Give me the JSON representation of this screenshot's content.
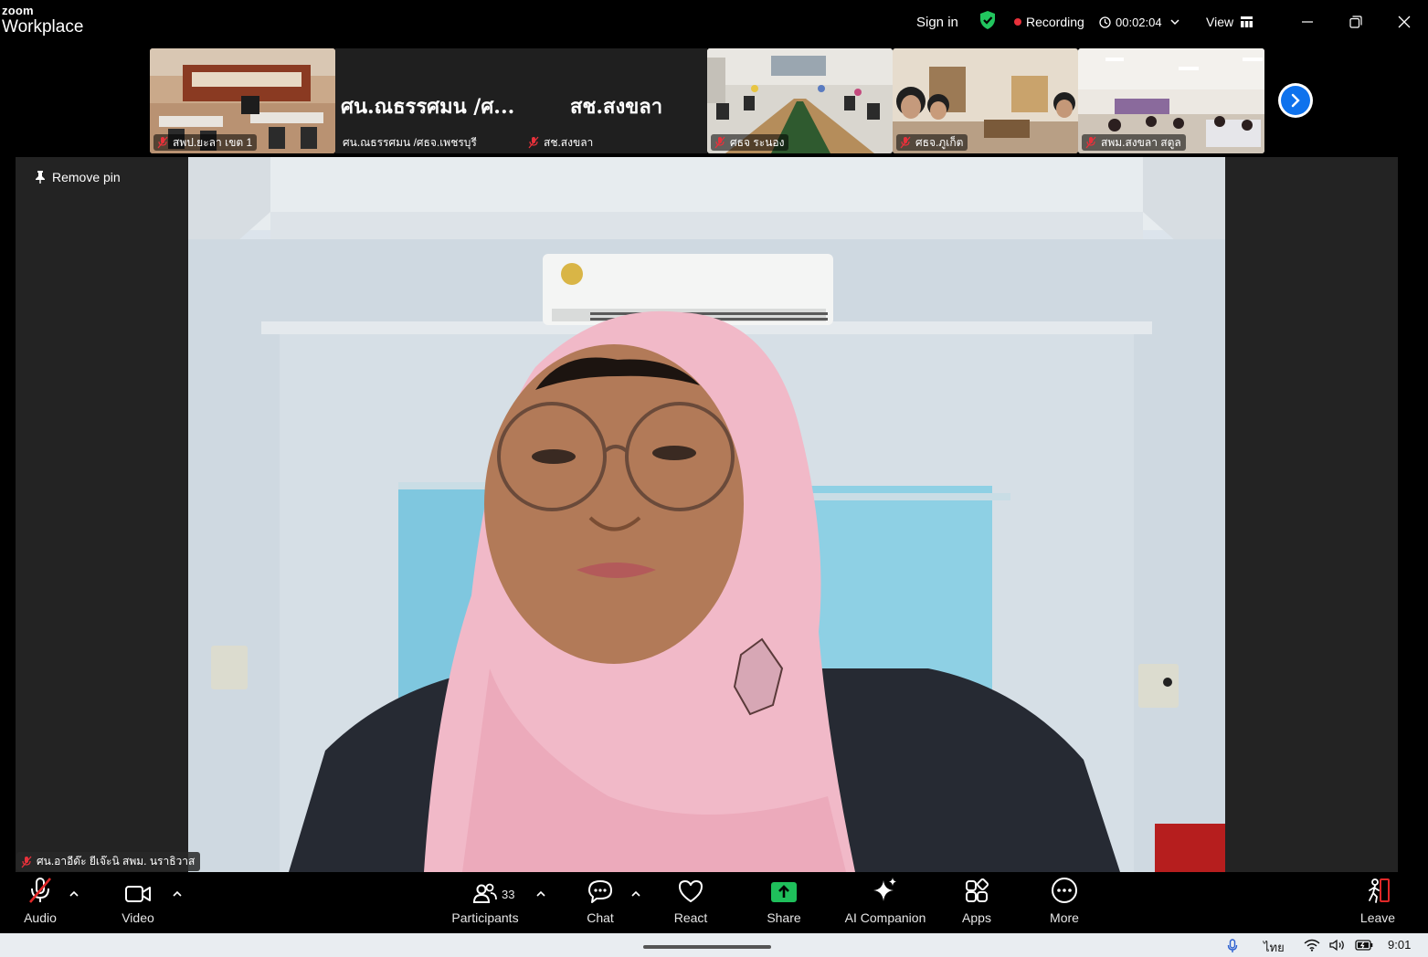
{
  "app": {
    "brand_small": "zoom",
    "brand_name": "Workplace"
  },
  "titlebar": {
    "sign_in": "Sign in",
    "recording": "Recording",
    "timer": "00:02:04",
    "view": "View"
  },
  "thumbnails": [
    {
      "label": "สพป.ยะลา เขต 1"
    },
    {
      "label": "ศน.ณธรรศมน /ศธจ.เพชรบุรี",
      "big_name": "ศน.ณธรรศมน /ศ..."
    },
    {
      "label": "สช.สงขลา",
      "big_name": "สช.สงขลา"
    },
    {
      "label": "ศธจ ระนอง"
    },
    {
      "label": "ศธจ.ภูเก็ต"
    },
    {
      "label": "สพม.สงขลา สตูล"
    }
  ],
  "main": {
    "remove_pin": "Remove pin",
    "speaker_label": "ศน.อาอีด๊ะ ยีเจ๊ะนิ  สพม. นราธิวาส"
  },
  "toolbar": {
    "audio": "Audio",
    "video": "Video",
    "participants": "Participants",
    "participants_count": "33",
    "chat": "Chat",
    "react": "React",
    "share": "Share",
    "ai_companion": "AI Companion",
    "apps": "Apps",
    "more": "More",
    "leave": "Leave"
  },
  "taskbar": {
    "language": "ไทย",
    "clock": "9:01"
  },
  "colors": {
    "accent_blue": "#0e72ed",
    "share_green": "#1fbf5b",
    "recording_red": "#e8313b",
    "leave_red": "#e02828",
    "shield_green": "#22c55e"
  }
}
